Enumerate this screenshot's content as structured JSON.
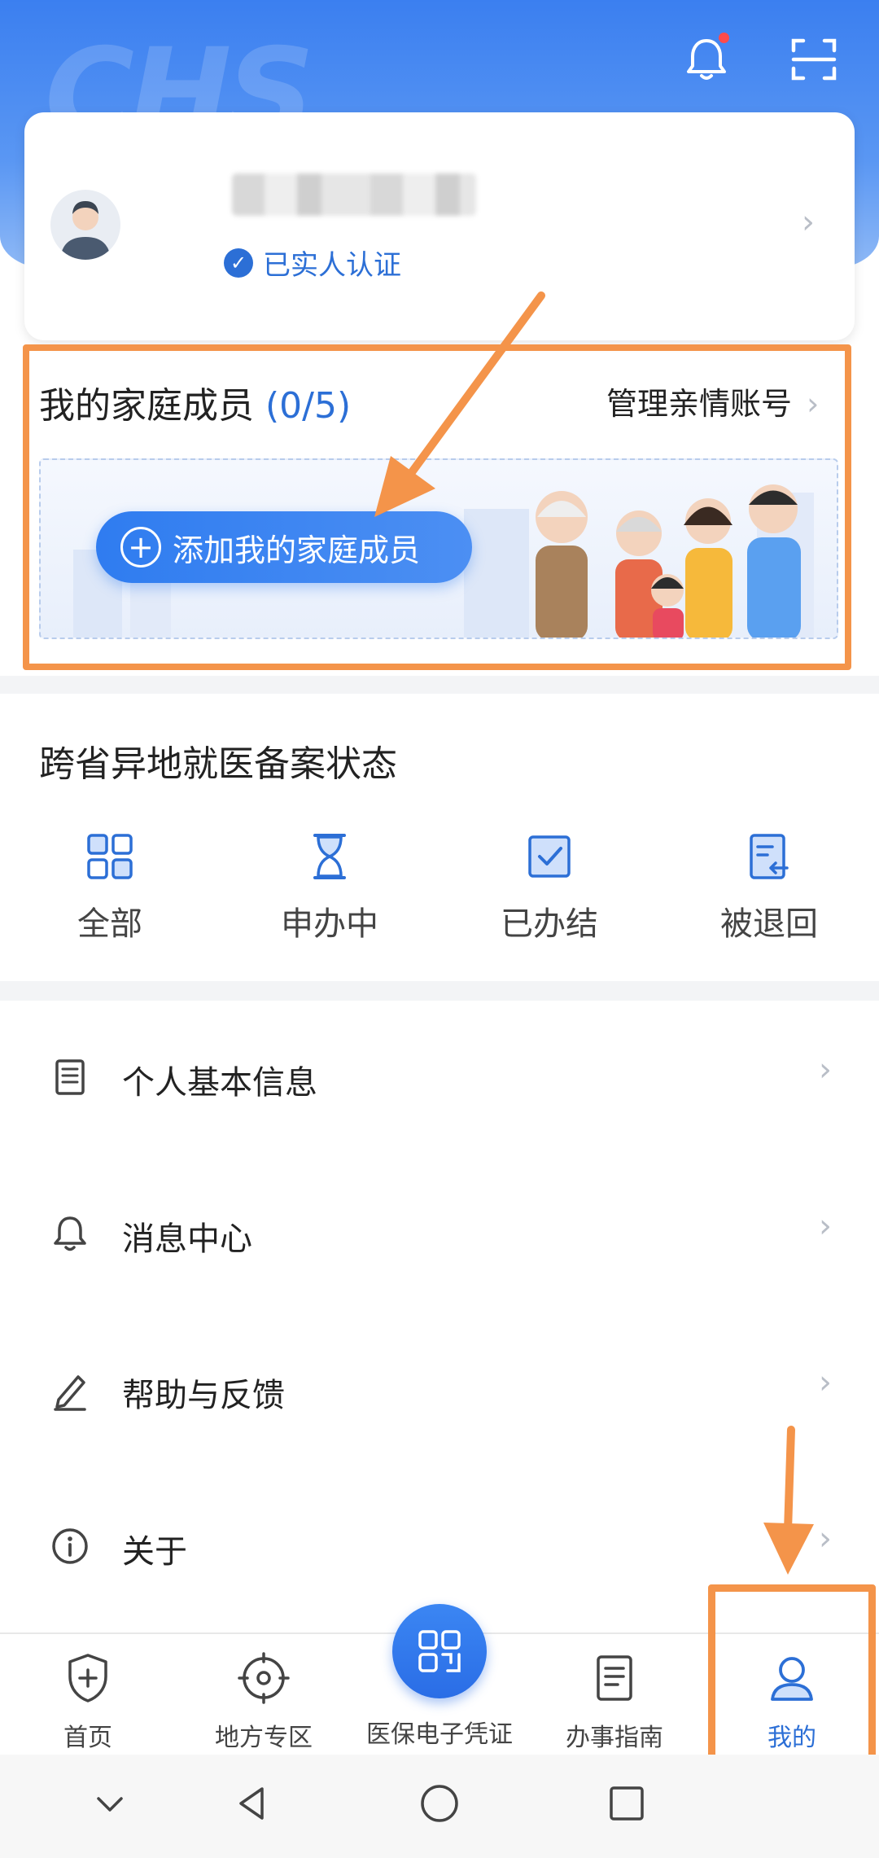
{
  "header": {
    "watermark": "CHS",
    "notification_icon": "bell-icon",
    "scan_icon": "scan-icon",
    "accent": "#3b7ff0"
  },
  "profile": {
    "name_masked": "",
    "verified_text": "已实人认证"
  },
  "family": {
    "title": "我的家庭成员",
    "count": "(0/5)",
    "manage_link": "管理亲情账号",
    "add_button": "添加我的家庭成员"
  },
  "records": {
    "title": "跨省异地就医备案状态",
    "statuses": [
      {
        "label": "全部",
        "icon": "grid-icon"
      },
      {
        "label": "申办中",
        "icon": "hourglass-icon"
      },
      {
        "label": "已办结",
        "icon": "check-icon"
      },
      {
        "label": "被退回",
        "icon": "return-doc-icon"
      }
    ]
  },
  "menu": [
    {
      "label": "个人基本信息",
      "icon": "document-icon"
    },
    {
      "label": "消息中心",
      "icon": "bell-icon"
    },
    {
      "label": "帮助与反馈",
      "icon": "pen-icon"
    },
    {
      "label": "关于",
      "icon": "info-icon"
    }
  ],
  "tabs": [
    {
      "label": "首页",
      "icon": "shield-plus-icon",
      "active": false
    },
    {
      "label": "地方专区",
      "icon": "target-icon",
      "active": false
    },
    {
      "label": "医保电子凭证",
      "icon": "qr-icon",
      "active": false
    },
    {
      "label": "办事指南",
      "icon": "guide-doc-icon",
      "active": false
    },
    {
      "label": "我的",
      "icon": "user-icon",
      "active": true
    }
  ],
  "colors": {
    "active_tab": "#2c6fd6",
    "annotation": "#f4944a"
  }
}
